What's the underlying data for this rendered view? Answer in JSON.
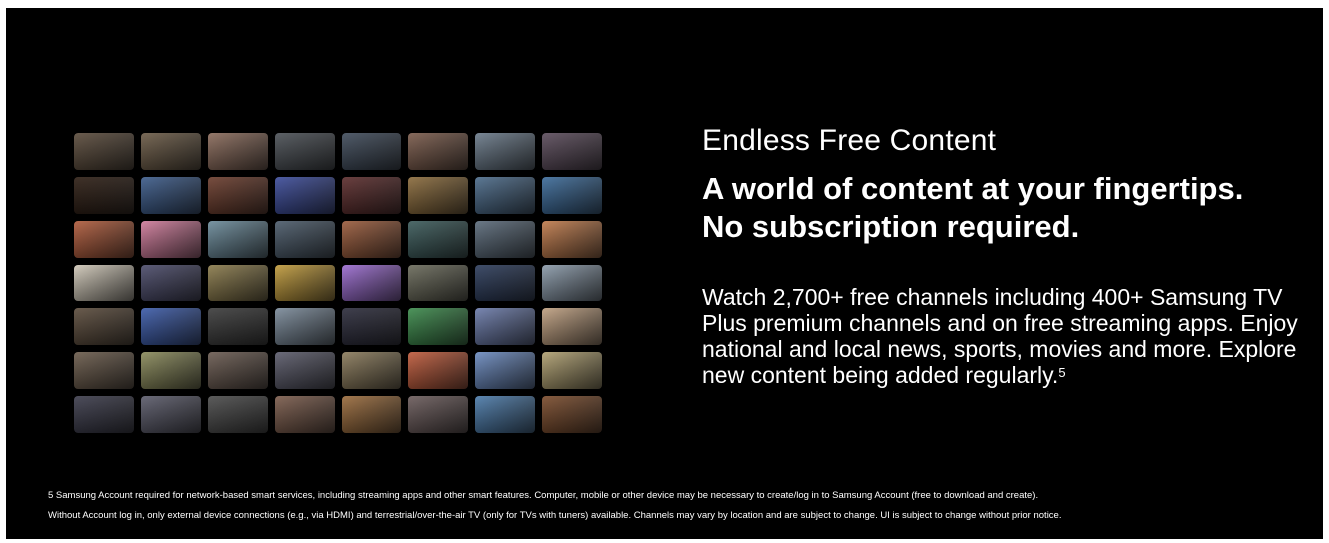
{
  "section": {
    "eyebrow": "Endless Free Content",
    "headline_line1": "A world of content at your fingertips.",
    "headline_line2": "No subscription required.",
    "body": "Watch 2,700+ free channels including 400+ Samsung TV Plus premium channels and on free streaming apps. Enjoy national and local news, sports, movies and more. Explore new content being added regularly.",
    "footnote_ref": "5"
  },
  "disclaimer": {
    "line1": "5 Samsung Account required for network-based smart services, including streaming apps and other smart features. Computer, mobile or other device may be necessary to create/log in to Samsung Account (free to download and create).",
    "line2": "Without Account log in, only external device connections (e.g., via HDMI) and terrestrial/over-the-air TV (only for TVs with tuners) available. Channels may vary by location and are subject to change. UI is subject to change without prior notice."
  },
  "mosaic": {
    "tile_colors": [
      "#5a4a3a",
      "#6b5a45",
      "#8a6a5a",
      "#4a4f55",
      "#3e4a5a",
      "#7a5a4a",
      "#6a7a8a",
      "#5a4a5a",
      "#2a1a10",
      "#3a5a8a",
      "#6a3a2a",
      "#3a4a9a",
      "#5a2a2a",
      "#8a6a3a",
      "#4a6a8a",
      "#3a6a9a",
      "#b05a3a",
      "#d07a9a",
      "#6a8a9a",
      "#4a5a6a",
      "#9a5a3a",
      "#3a5a5a",
      "#5a6a7a",
      "#c07a4a",
      "#d0c8b8",
      "#4a4a6a",
      "#8a7a4a",
      "#c09a3a",
      "#9a6ad0",
      "#6a6a5a",
      "#2a3a5a",
      "#8a9aaa",
      "#5a4a3a",
      "#3a5aaa",
      "#3a3a3a",
      "#7a8a9a",
      "#2a2a3a",
      "#3a8a4a",
      "#6a7aaa",
      "#c0a080",
      "#6a5a4a",
      "#8a8a5a",
      "#6a5a50",
      "#5a5a6a",
      "#8a7a5a",
      "#c05a3a",
      "#6a8ac0",
      "#b0a070",
      "#3a3a4a",
      "#5a5a6a",
      "#4a4a4a",
      "#7a5a4a",
      "#9a6a3a",
      "#6a5a5a",
      "#4a7aaa",
      "#7a4a2a"
    ]
  }
}
